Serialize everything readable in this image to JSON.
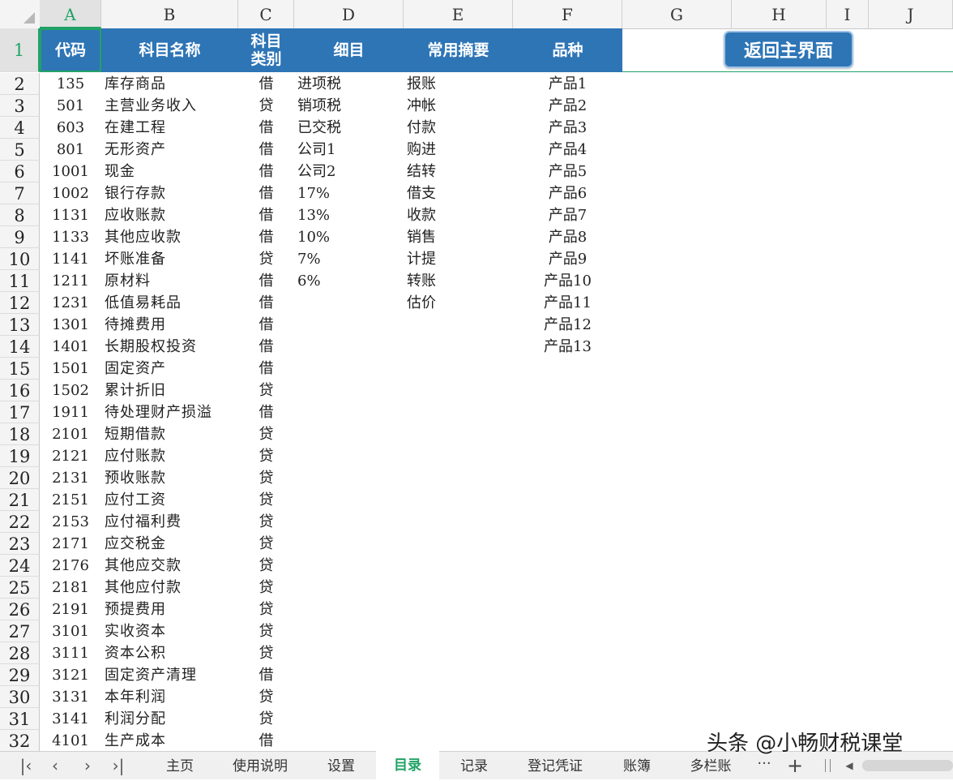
{
  "columns": [
    "A",
    "B",
    "C",
    "D",
    "E",
    "F",
    "G",
    "H",
    "I",
    "J"
  ],
  "header_row": {
    "row_number": "1",
    "code": "代码",
    "subject_name": "科目名称",
    "subject_type": "科目\n类别",
    "detail": "细目",
    "summary": "常用摘要",
    "product": "品种"
  },
  "return_button": "返回主界面",
  "accounts": [
    {
      "row": "2",
      "code": "135",
      "name": "库存商品",
      "type": "借"
    },
    {
      "row": "3",
      "code": "501",
      "name": "主营业务收入",
      "type": "贷"
    },
    {
      "row": "4",
      "code": "603",
      "name": "在建工程",
      "type": "借"
    },
    {
      "row": "5",
      "code": "801",
      "name": "无形资产",
      "type": "借"
    },
    {
      "row": "6",
      "code": "1001",
      "name": "现金",
      "type": "借"
    },
    {
      "row": "7",
      "code": "1002",
      "name": "银行存款",
      "type": "借"
    },
    {
      "row": "8",
      "code": "1131",
      "name": "应收账款",
      "type": "借"
    },
    {
      "row": "9",
      "code": "1133",
      "name": "其他应收款",
      "type": "借"
    },
    {
      "row": "10",
      "code": "1141",
      "name": "坏账准备",
      "type": "贷"
    },
    {
      "row": "11",
      "code": "1211",
      "name": "原材料",
      "type": "借"
    },
    {
      "row": "12",
      "code": "1231",
      "name": "低值易耗品",
      "type": "借"
    },
    {
      "row": "13",
      "code": "1301",
      "name": "待摊费用",
      "type": "借"
    },
    {
      "row": "14",
      "code": "1401",
      "name": "长期股权投资",
      "type": "借"
    },
    {
      "row": "15",
      "code": "1501",
      "name": "固定资产",
      "type": "借"
    },
    {
      "row": "16",
      "code": "1502",
      "name": "累计折旧",
      "type": "贷"
    },
    {
      "row": "17",
      "code": "1911",
      "name": "待处理财产损溢",
      "type": "借"
    },
    {
      "row": "18",
      "code": "2101",
      "name": "短期借款",
      "type": "贷"
    },
    {
      "row": "19",
      "code": "2121",
      "name": "应付账款",
      "type": "贷"
    },
    {
      "row": "20",
      "code": "2131",
      "name": "预收账款",
      "type": "贷"
    },
    {
      "row": "21",
      "code": "2151",
      "name": "应付工资",
      "type": "贷"
    },
    {
      "row": "22",
      "code": "2153",
      "name": "应付福利费",
      "type": "贷"
    },
    {
      "row": "23",
      "code": "2171",
      "name": "应交税金",
      "type": "贷"
    },
    {
      "row": "24",
      "code": "2176",
      "name": "其他应交款",
      "type": "贷"
    },
    {
      "row": "25",
      "code": "2181",
      "name": "其他应付款",
      "type": "贷"
    },
    {
      "row": "26",
      "code": "2191",
      "name": "预提费用",
      "type": "贷"
    },
    {
      "row": "27",
      "code": "3101",
      "name": "实收资本",
      "type": "贷"
    },
    {
      "row": "28",
      "code": "3111",
      "name": "资本公积",
      "type": "贷"
    },
    {
      "row": "29",
      "code": "3121",
      "name": "固定资产清理",
      "type": "借"
    },
    {
      "row": "30",
      "code": "3131",
      "name": "本年利润",
      "type": "贷"
    },
    {
      "row": "31",
      "code": "3141",
      "name": "利润分配",
      "type": "贷"
    },
    {
      "row": "32",
      "code": "4101",
      "name": "生产成本",
      "type": "借"
    }
  ],
  "details": [
    "进项税",
    "销项税",
    "已交税",
    "公司1",
    "公司2",
    "17%",
    "13%",
    "10%",
    "7%",
    "6%"
  ],
  "summaries": [
    "报账",
    "冲帐",
    "付款",
    "购进",
    "结转",
    "借支",
    "收款",
    "销售",
    "计提",
    "转账",
    "估价"
  ],
  "products": [
    "产品1",
    "产品2",
    "产品3",
    "产品4",
    "产品5",
    "产品6",
    "产品7",
    "产品8",
    "产品9",
    "产品10",
    "产品11",
    "产品12",
    "产品13"
  ],
  "sheet_tabs": [
    {
      "label": "主页",
      "active": false
    },
    {
      "label": "使用说明",
      "active": false
    },
    {
      "label": "设置",
      "active": false
    },
    {
      "label": "目录",
      "active": true
    },
    {
      "label": "记录",
      "active": false
    },
    {
      "label": "登记凭证",
      "active": false
    },
    {
      "label": "账簿",
      "active": false
    },
    {
      "label": "多栏账",
      "active": false
    }
  ],
  "tab_nav": {
    "first": "|‹",
    "prev": "‹",
    "next": "›",
    "last": "›|",
    "more": "···",
    "add": "+"
  },
  "watermark": "头条 @小畅财税课堂",
  "colors": {
    "header_blue": "#2e75b6",
    "active_green": "#21a366"
  },
  "icons": [
    "select-all-corner-icon",
    "first-sheet-icon",
    "prev-sheet-icon",
    "next-sheet-icon",
    "last-sheet-icon",
    "more-sheets-icon",
    "add-sheet-icon",
    "scroll-left-icon"
  ]
}
